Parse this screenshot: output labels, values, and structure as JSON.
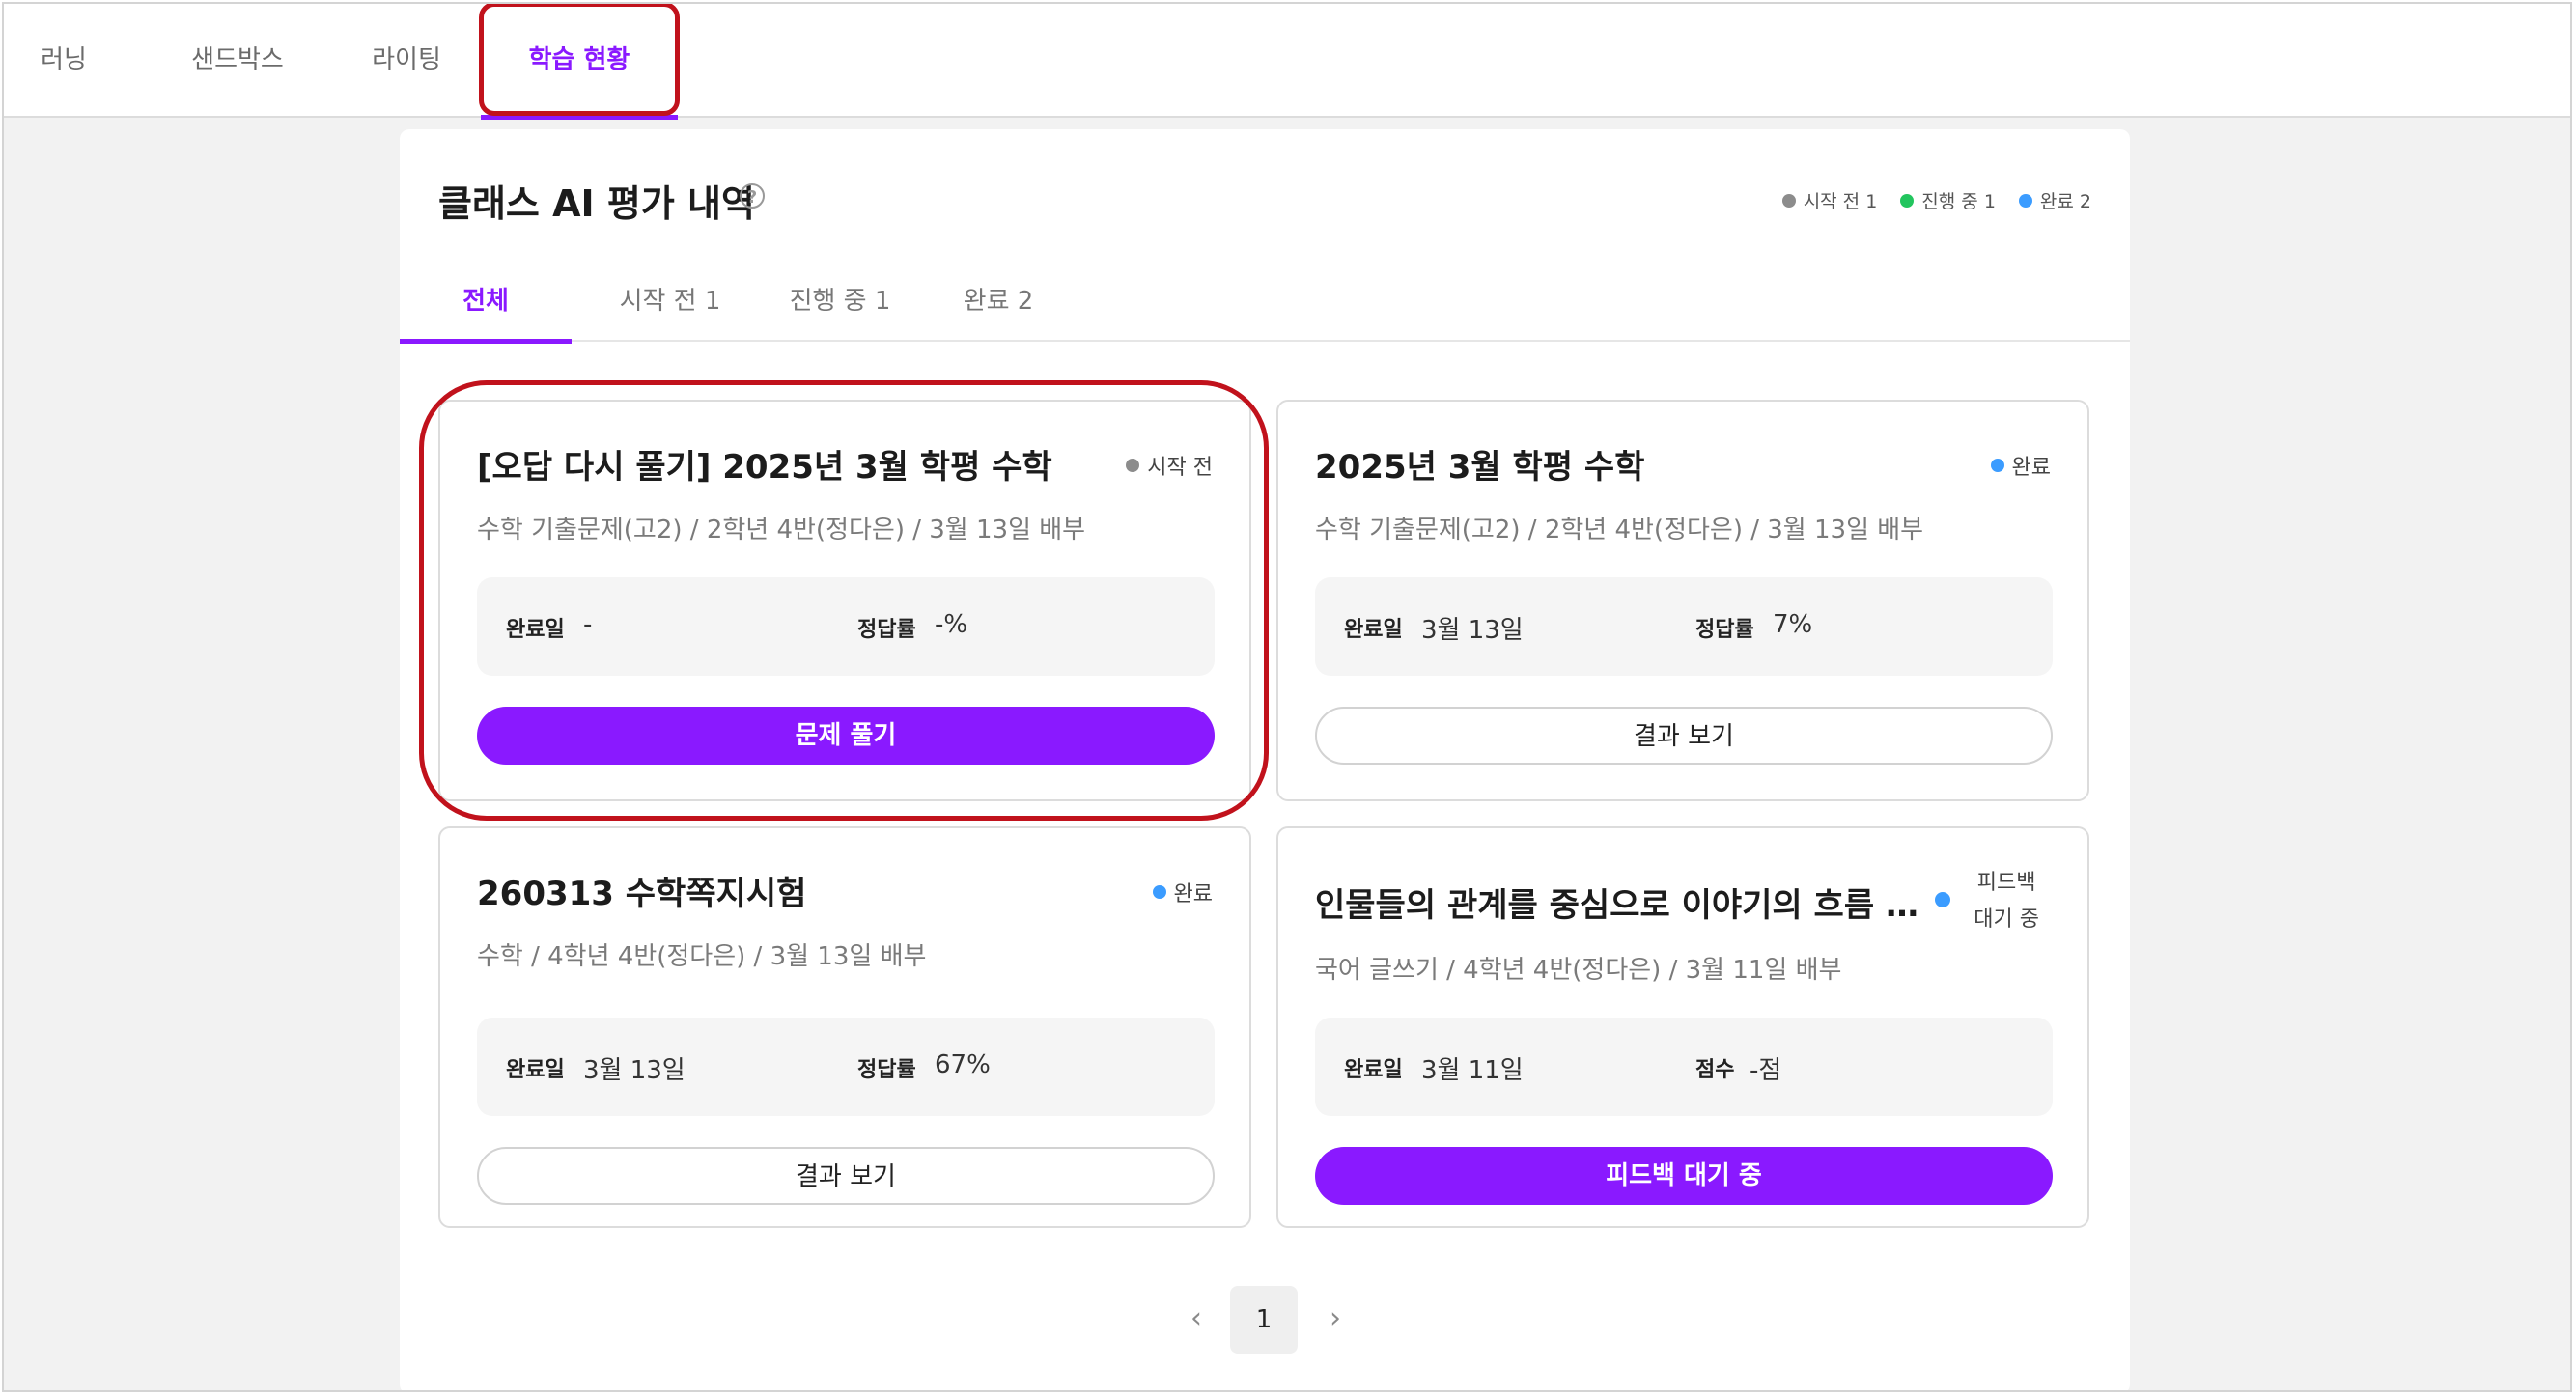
{
  "top_nav": {
    "tabs": [
      {
        "label": "러닝"
      },
      {
        "label": "샌드박스"
      },
      {
        "label": "라이팅"
      },
      {
        "label": "학습 현황"
      }
    ],
    "active_index": 3
  },
  "panel": {
    "title": "클래스 AI 평가 내역",
    "help_glyph": "?",
    "legend": [
      {
        "label": "시작 전 1",
        "color": "#8c8c8c"
      },
      {
        "label": "진행 중 1",
        "color": "#22c55e"
      },
      {
        "label": "완료 2",
        "color": "#3b9cff"
      }
    ],
    "tabs": [
      {
        "label": "전체"
      },
      {
        "label": "시작 전 1"
      },
      {
        "label": "진행 중 1"
      },
      {
        "label": "완료 2"
      }
    ],
    "active_tab": 0
  },
  "cards": [
    {
      "title": "[오답 다시 풀기] 2025년 3월 학평 수학",
      "status": "시작 전",
      "status_color": "#8c8c8c",
      "subtitle": "수학 기출문제(고2) / 2학년 4반(정다은) / 3월 13일 배부",
      "info1_label": "완료일",
      "info1_value": "-",
      "info2_label": "정답률",
      "info2_value": "-%",
      "button": "문제 풀기",
      "button_style": "primary"
    },
    {
      "title": "2025년 3월 학평 수학",
      "status": "완료",
      "status_color": "#3b9cff",
      "subtitle": "수학 기출문제(고2) / 2학년 4반(정다은) / 3월 13일 배부",
      "info1_label": "완료일",
      "info1_value": "3월 13일",
      "info2_label": "정답률",
      "info2_value": "7%",
      "button": "결과 보기",
      "button_style": "outline"
    },
    {
      "title": "260313 수학쪽지시험",
      "status": "완료",
      "status_color": "#3b9cff",
      "subtitle": "수학 / 4학년 4반(정다은) / 3월 13일 배부",
      "info1_label": "완료일",
      "info1_value": "3월 13일",
      "info2_label": "정답률",
      "info2_value": "67%",
      "button": "결과 보기",
      "button_style": "outline"
    },
    {
      "title": "인물들의 관계를 중심으로 이야기의 흐름 파악하기",
      "status_line1": "피드백",
      "status_line2": "대기 중",
      "status_color": "#3b9cff",
      "subtitle": "국어 글쓰기 / 4학년 4반(정다은) / 3월 11일 배부",
      "info1_label": "완료일",
      "info1_value": "3월 11일",
      "info2_label": "점수",
      "info2_value": "-점",
      "button": "피드백 대기 중",
      "button_style": "primary"
    }
  ],
  "pagination": {
    "prev_glyph": "‹",
    "current_page": "1",
    "next_glyph": "›"
  }
}
